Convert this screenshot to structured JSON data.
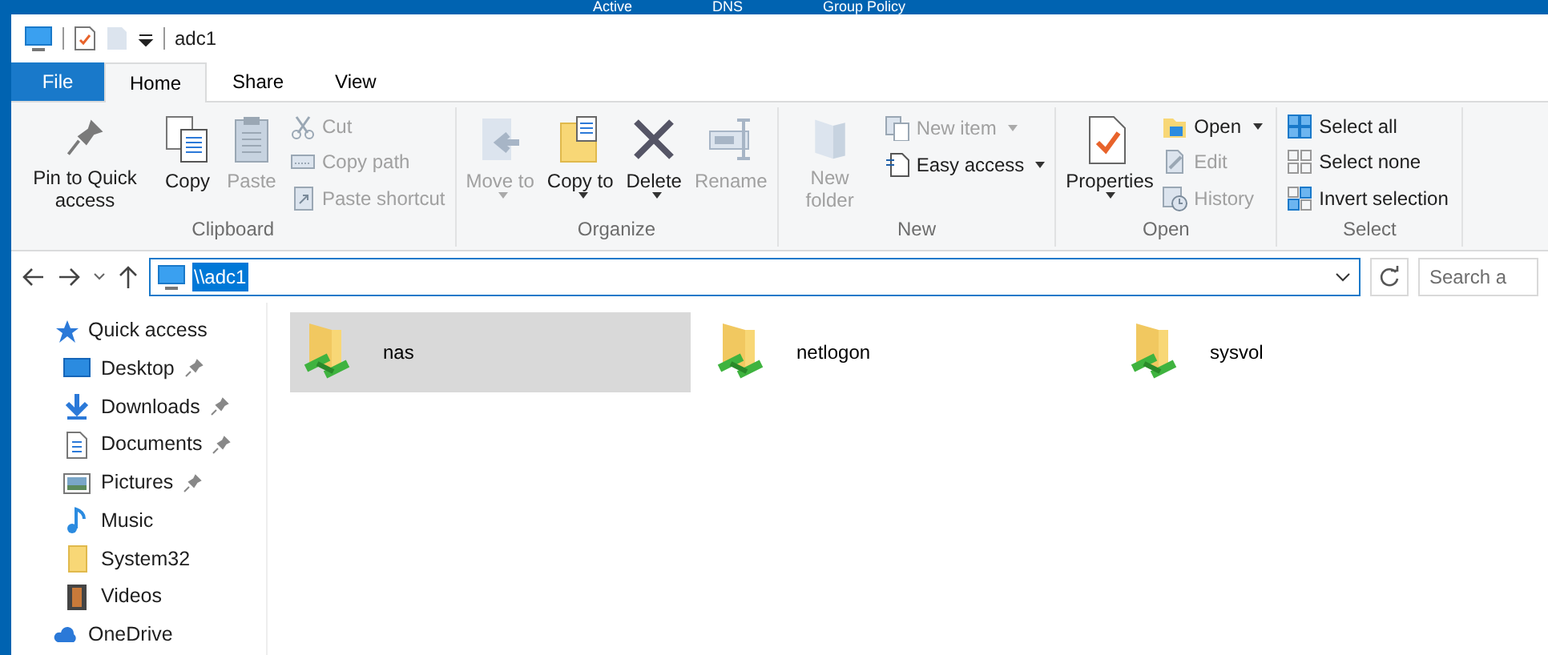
{
  "background_tabs": [
    {
      "label": "Active"
    },
    {
      "label": "DNS"
    },
    {
      "label": "Group Policy"
    }
  ],
  "window": {
    "title": "adc1"
  },
  "ribbon_tabs": [
    {
      "label": "File",
      "kind": "file",
      "selected": false
    },
    {
      "label": "Home",
      "kind": "tab",
      "selected": true
    },
    {
      "label": "Share",
      "kind": "tab",
      "selected": false
    },
    {
      "label": "View",
      "kind": "tab",
      "selected": false
    }
  ],
  "ribbon_groups": [
    {
      "label": "Clipboard",
      "items": [
        {
          "kind": "large",
          "label": "Pin to Quick access",
          "disabled": false,
          "dropdown": false
        },
        {
          "kind": "large",
          "label": "Copy",
          "disabled": false,
          "dropdown": false
        },
        {
          "kind": "large",
          "label": "Paste",
          "disabled": true,
          "dropdown": false
        },
        {
          "kind": "small",
          "label": "Cut",
          "disabled": true,
          "dropdown": false
        },
        {
          "kind": "small",
          "label": "Copy path",
          "disabled": true,
          "dropdown": false
        },
        {
          "kind": "small",
          "label": "Paste shortcut",
          "disabled": true,
          "dropdown": false
        }
      ]
    },
    {
      "label": "Organize",
      "items": [
        {
          "kind": "large",
          "label": "Move to",
          "disabled": true,
          "dropdown": true
        },
        {
          "kind": "large",
          "label": "Copy to",
          "disabled": false,
          "dropdown": true
        },
        {
          "kind": "large",
          "label": "Delete",
          "disabled": false,
          "dropdown": true
        },
        {
          "kind": "large",
          "label": "Rename",
          "disabled": true,
          "dropdown": false
        }
      ]
    },
    {
      "label": "New",
      "items": [
        {
          "kind": "large",
          "label": "New folder",
          "disabled": true,
          "dropdown": false
        },
        {
          "kind": "small",
          "label": "New item",
          "disabled": true,
          "dropdown": true
        },
        {
          "kind": "small",
          "label": "Easy access",
          "disabled": false,
          "dropdown": true
        }
      ]
    },
    {
      "label": "Open",
      "items": [
        {
          "kind": "large",
          "label": "Properties",
          "disabled": false,
          "dropdown": true
        },
        {
          "kind": "small",
          "label": "Open",
          "disabled": false,
          "dropdown": true
        },
        {
          "kind": "small",
          "label": "Edit",
          "disabled": true,
          "dropdown": false
        },
        {
          "kind": "small",
          "label": "History",
          "disabled": true,
          "dropdown": false
        }
      ]
    },
    {
      "label": "Select",
      "items": [
        {
          "kind": "small",
          "label": "Select all",
          "disabled": false,
          "dropdown": false
        },
        {
          "kind": "small",
          "label": "Select none",
          "disabled": false,
          "dropdown": false
        },
        {
          "kind": "small",
          "label": "Invert selection",
          "disabled": false,
          "dropdown": false
        }
      ]
    }
  ],
  "address_bar": {
    "path": "\\\\adc1",
    "text_selected": true
  },
  "search": {
    "placeholder": "Search a"
  },
  "navigation": [
    {
      "label": "Quick access",
      "children": [
        {
          "label": "Desktop",
          "pinned": true
        },
        {
          "label": "Downloads",
          "pinned": true
        },
        {
          "label": "Documents",
          "pinned": true
        },
        {
          "label": "Pictures",
          "pinned": true
        },
        {
          "label": "Music",
          "pinned": false
        },
        {
          "label": "System32",
          "pinned": false
        },
        {
          "label": "Videos",
          "pinned": false
        }
      ]
    },
    {
      "label": "OneDrive"
    }
  ],
  "shares": [
    {
      "name": "nas",
      "selected": true
    },
    {
      "name": "netlogon",
      "selected": false
    },
    {
      "name": "sysvol",
      "selected": false
    }
  ]
}
